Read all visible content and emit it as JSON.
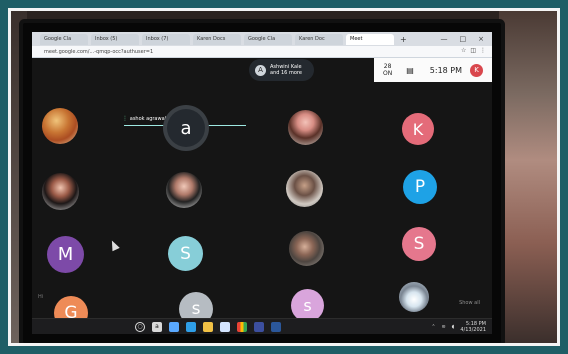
{
  "browser": {
    "tabs": [
      {
        "label": "Google Cla"
      },
      {
        "label": "Inbox (5)"
      },
      {
        "label": "Inbox (7)"
      },
      {
        "label": "Karen Docs"
      },
      {
        "label": "Google Cla"
      },
      {
        "label": "Karen Doc"
      },
      {
        "label": "Meet"
      }
    ],
    "address": "meet.google.com/...-qmqp-occ?authuser=1",
    "window_minimize": "—",
    "window_maximize": "□",
    "window_close": "×",
    "tab_plus": "+"
  },
  "meet": {
    "presenter": "Ashwini Kale",
    "presenter_more": "and 16 more",
    "speaker_name": "ashok agrawal",
    "participant_count": "28",
    "people_label": "ON",
    "time": "5:18 PM",
    "user_badge": "K",
    "corner_label": "Show all",
    "left_chip": "Hi"
  },
  "participants": [
    {
      "name": "food-photo"
    },
    {
      "name": "a",
      "letter": "a"
    },
    {
      "name": "woman-photo-1"
    },
    {
      "name": "K",
      "letter": "K"
    },
    {
      "name": "woman-photo-2"
    },
    {
      "name": "woman-photo-3"
    },
    {
      "name": "woman-photo-4"
    },
    {
      "name": "P",
      "letter": "P"
    },
    {
      "name": "M",
      "letter": "M"
    },
    {
      "name": "S1",
      "letter": "S"
    },
    {
      "name": "couple-photo"
    },
    {
      "name": "S2",
      "letter": "S"
    },
    {
      "name": "G",
      "letter": "G"
    },
    {
      "name": "s",
      "letter": "s"
    },
    {
      "name": "s-lilac",
      "letter": "s"
    },
    {
      "name": "car-photo"
    }
  ],
  "taskbar": {
    "search": "○",
    "clock_time": "5:18 PM",
    "clock_date": "4/13/2021"
  },
  "colors": {
    "background": "#1f5e66",
    "meet_dark": "#151515",
    "accent_blue": "#1ea2e6",
    "accent_purple": "#7d4aa8"
  }
}
